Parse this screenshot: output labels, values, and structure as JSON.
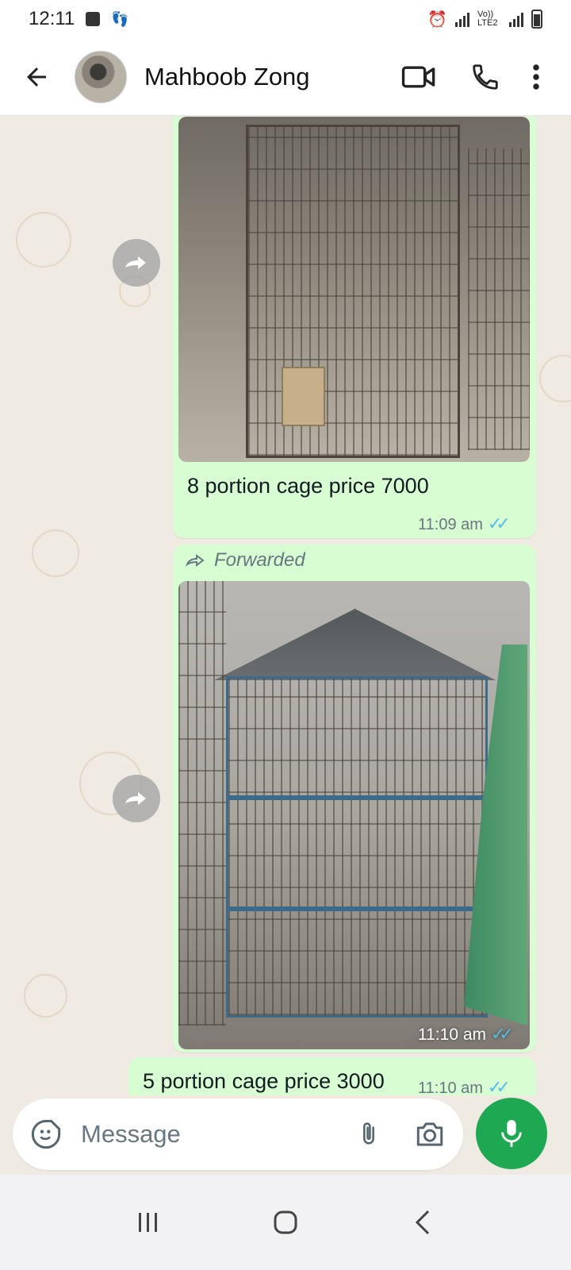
{
  "status_bar": {
    "time": "12:11",
    "network": "Vo)) LTE2"
  },
  "header": {
    "contact_name": "Mahboob Zong"
  },
  "messages": [
    {
      "type": "image",
      "caption": "8 portion cage price 7000",
      "time": "11:09 am",
      "ticks": "✓✓"
    },
    {
      "type": "image",
      "forwarded_label": "Forwarded",
      "time": "11:10 am",
      "ticks": "✓✓"
    },
    {
      "type": "text",
      "text": "5 portion cage price 3000",
      "time": "11:10 am",
      "ticks": "✓✓"
    }
  ],
  "input": {
    "placeholder": "Message"
  },
  "icons": {
    "back": "arrow-left-icon",
    "video": "video-call-icon",
    "call": "phone-icon",
    "menu": "more-vert-icon",
    "emoji": "sticker-icon",
    "attach": "paperclip-icon",
    "camera": "camera-icon",
    "mic": "mic-icon",
    "forward": "forward-icon"
  },
  "colors": {
    "bubble": "#d9fdd3",
    "chat_bg": "#efeae2",
    "mic": "#1da851",
    "ticks": "#53bdeb"
  }
}
